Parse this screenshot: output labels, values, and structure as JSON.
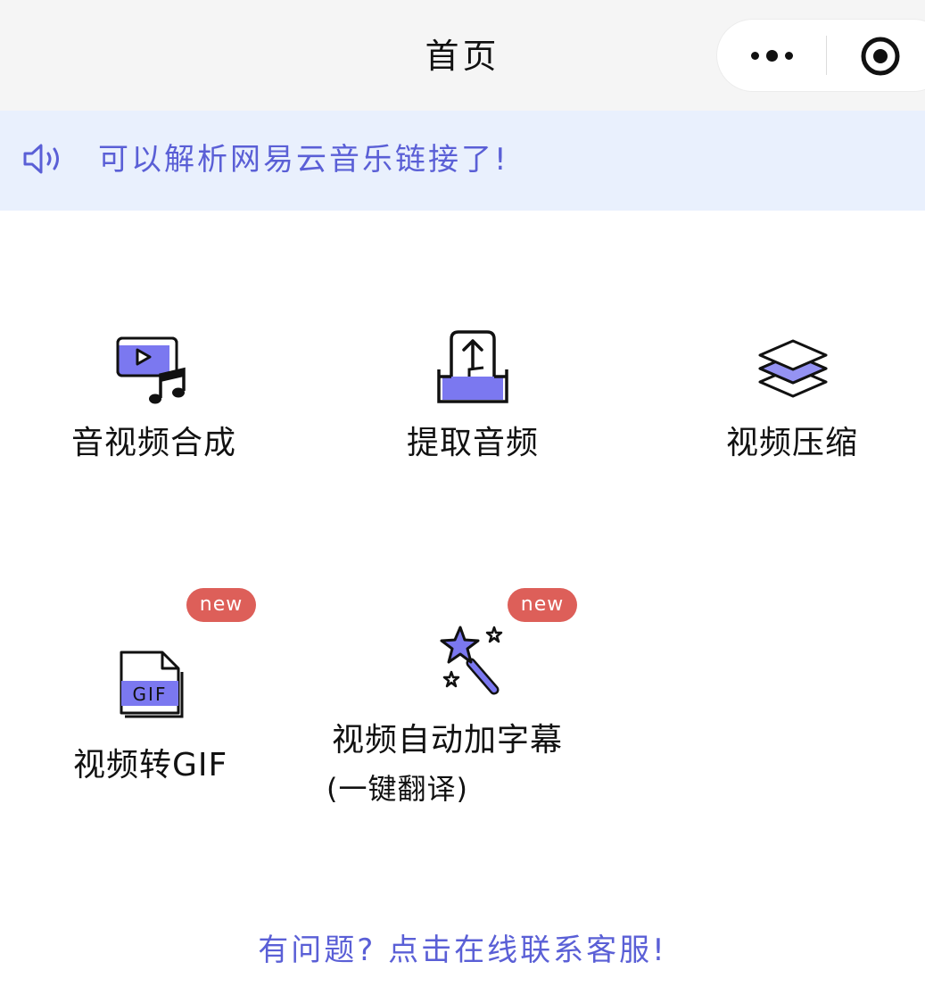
{
  "navbar": {
    "title": "首页",
    "more_icon": "more-dots-icon",
    "close_icon": "target-circle-icon"
  },
  "notice": {
    "icon": "speaker-icon",
    "text": "可以解析网易云音乐链接了!"
  },
  "features": [
    {
      "label": "音视频合成",
      "icon": "video-music-icon",
      "badge": ""
    },
    {
      "label": "提取音频",
      "icon": "extract-audio-icon",
      "badge": ""
    },
    {
      "label": "视频压缩",
      "icon": "layers-icon",
      "badge": ""
    },
    {
      "label": "视频转GIF",
      "icon": "gif-file-icon",
      "badge": "new"
    },
    {
      "label": "视频自动加字幕",
      "sublabel": "(一键翻译)",
      "icon": "magic-wand-icon",
      "badge": "new"
    }
  ],
  "footer": {
    "text": "有问题? 点击在线联系客服!"
  },
  "colors": {
    "accent": "#5a5fd6",
    "icon_fill": "#7b78f0",
    "notice_bg": "#e9f0fd",
    "badge": "#dd5f59"
  }
}
